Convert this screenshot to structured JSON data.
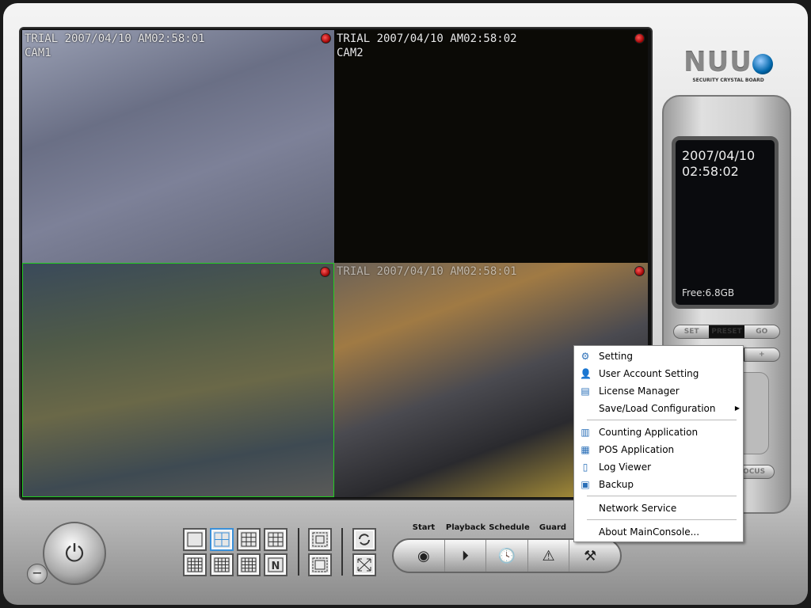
{
  "cameras": [
    {
      "osd": "TRIAL 2007/04/10 AM02:58:01",
      "name": "CAM1"
    },
    {
      "osd": "TRIAL 2007/04/10 AM02:58:02",
      "name": "CAM2"
    },
    {
      "osd": "",
      "name": ""
    },
    {
      "osd": "TRIAL 2007/04/10 AM02:58:01",
      "name": ""
    }
  ],
  "logo": {
    "brand": "NUUO",
    "tagline": "SECURITY CRYSTAL BOARD"
  },
  "lcd": {
    "date": "2007/04/10",
    "time": "02:58:02",
    "free": "Free:6.8GB"
  },
  "preset": {
    "set": "SET",
    "preset": "PRESET",
    "go": "GO",
    "plus": "+",
    "focus": "FOCUS"
  },
  "toolbar": {
    "labels": [
      "Start",
      "Playback",
      "Schedule",
      "Guard"
    ]
  },
  "menu": {
    "items": [
      {
        "label": "Setting",
        "icon": "gear-icon"
      },
      {
        "label": "User Account Setting",
        "icon": "user-icon"
      },
      {
        "label": "License Manager",
        "icon": "license-icon"
      },
      {
        "label": "Save/Load Configuration",
        "submenu": true
      },
      {
        "label": "Counting Application",
        "icon": "counting-icon"
      },
      {
        "label": "POS Application",
        "icon": "pos-icon"
      },
      {
        "label": "Log Viewer",
        "icon": "log-icon"
      },
      {
        "label": "Backup",
        "icon": "backup-icon"
      },
      {
        "label": "Network Service"
      },
      {
        "label": "About MainConsole..."
      }
    ]
  },
  "colors": {
    "selected_layout": "#3a8fd8",
    "active_camera_border": "#22cc22",
    "recording": "#cc0000"
  }
}
